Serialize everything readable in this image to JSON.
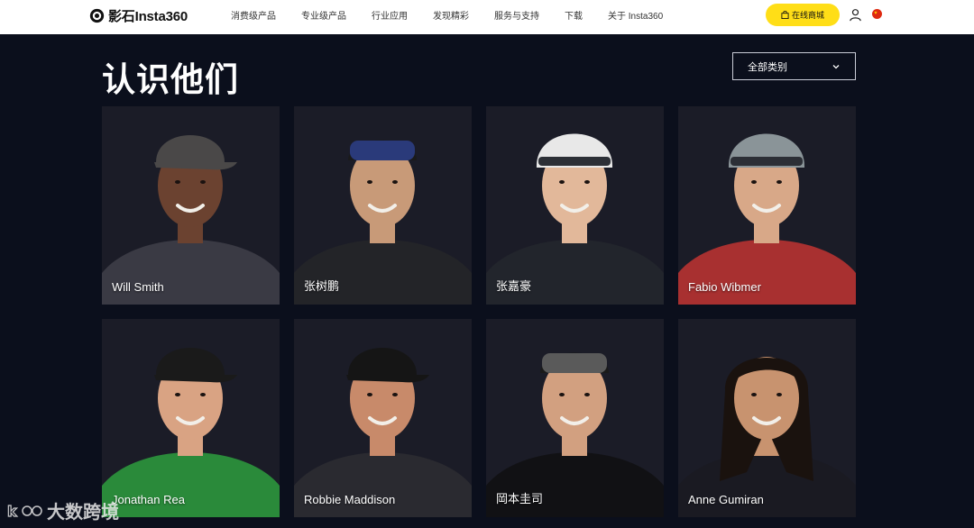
{
  "header": {
    "brand": "影石Insta360",
    "nav": [
      "消费级产品",
      "专业级产品",
      "行业应用",
      "发现精彩",
      "服务与支持",
      "下载",
      "关于 Insta360"
    ],
    "shop_label": "在线商城"
  },
  "main": {
    "title": "认识他们",
    "filter_value": "全部类别"
  },
  "cards": [
    {
      "name": "Will Smith",
      "skin": "#6b4230",
      "hair": "#2a2a2a",
      "top": "#3a3a44",
      "gear": "cap",
      "gear_color": "#4a4848",
      "bg": "#1b1c27"
    },
    {
      "name": "张树鹏",
      "skin": "#c89a78",
      "hair": "#1a1a1a",
      "top": "#232428",
      "gear": "goggles",
      "gear_color": "#2a3a7a",
      "bg": "#1b1c27"
    },
    {
      "name": "张嘉豪",
      "skin": "#e2b89a",
      "hair": "#3a2418",
      "top": "#22252c",
      "gear": "helmet",
      "gear_color": "#e8e8e8",
      "bg": "#1b1c27"
    },
    {
      "name": "Fabio Wibmer",
      "skin": "#d8a888",
      "hair": "#a07850",
      "top": "#a83030",
      "gear": "helmet",
      "gear_color": "#8a9498",
      "bg": "#1b1c27"
    },
    {
      "name": "Jonathan Rea",
      "skin": "#d9a383",
      "hair": "#2a2a2a",
      "top": "#2a8a3a",
      "gear": "cap",
      "gear_color": "#1a1a1a",
      "bg": "#1b1c27"
    },
    {
      "name": "Robbie Maddison",
      "skin": "#c88a6a",
      "hair": "#3a2a20",
      "top": "#2a2a30",
      "gear": "cap",
      "gear_color": "#151515",
      "bg": "#1b1c27"
    },
    {
      "name": "岡本圭司",
      "skin": "#d2a080",
      "hair": "#1a1a1a",
      "top": "#111114",
      "gear": "goggles",
      "gear_color": "#5a5a5a",
      "bg": "#1b1c27"
    },
    {
      "name": "Anne Gumiran",
      "skin": "#c8936f",
      "hair": "#1a120e",
      "top": "#1a1a22",
      "gear": "none",
      "gear_color": "#000000",
      "bg": "#1b1c27"
    }
  ],
  "watermark": {
    "text": "大数跨境"
  },
  "colors": {
    "accent": "#ffde17",
    "page_bg": "#0b0f1c",
    "card_bg": "#1b1c27"
  }
}
